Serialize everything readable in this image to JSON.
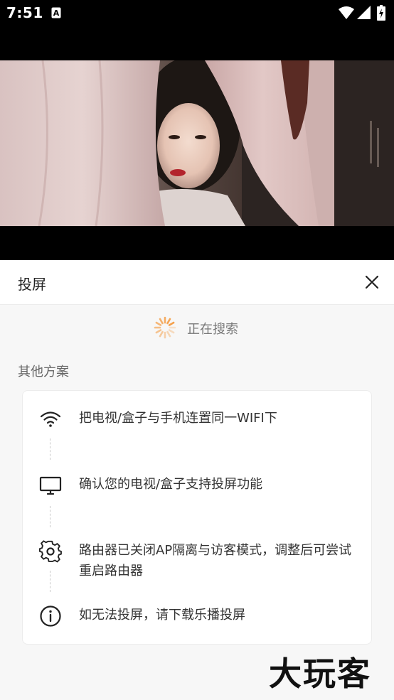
{
  "status_bar": {
    "time": "7:51",
    "notification_icon": "a-icon",
    "wifi_icon": "wifi-icon",
    "signal_icon": "signal-icon",
    "battery_icon": "battery-charging-icon"
  },
  "video": {
    "frame_description_icon": "video-frame-image"
  },
  "cast_panel": {
    "title": "投屏",
    "close_icon": "close-icon",
    "searching_text": "正在搜索",
    "other_options_heading": "其他方案",
    "options": [
      {
        "icon": "wifi-icon",
        "text": "把电视/盒子与手机连置同一WIFI下"
      },
      {
        "icon": "monitor-icon",
        "text": "确认您的电视/盒子支持投屏功能"
      },
      {
        "icon": "gear-icon",
        "text": "路由器已关闭AP隔离与访客模式，调整后可尝试重启路由器"
      },
      {
        "icon": "info-icon",
        "text": "如无法投屏，请下载乐播投屏"
      }
    ]
  },
  "watermark": {
    "text": "大玩客"
  },
  "colors": {
    "spinner": "#f5a04a",
    "sheet_background": "#f7f7f7",
    "card_background": "#ffffff",
    "primary_text": "#333333",
    "secondary_text": "#777777"
  }
}
